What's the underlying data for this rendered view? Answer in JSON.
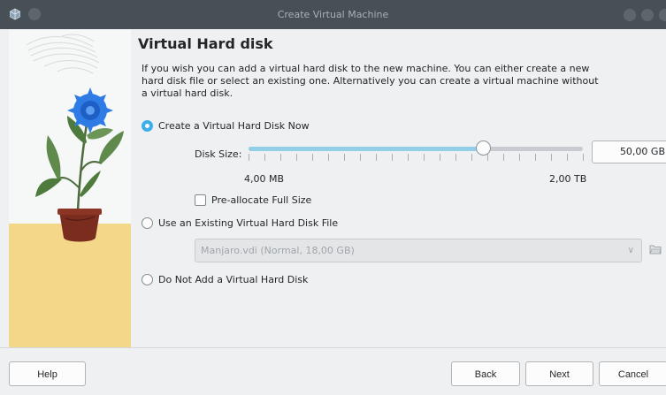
{
  "window": {
    "title": "Create Virtual Machine"
  },
  "page": {
    "heading": "Virtual Hard disk",
    "description": "If you wish you can add a virtual hard disk to the new machine. You can either create a new hard disk file or select an existing one. Alternatively you can create a virtual machine without a virtual hard disk."
  },
  "options": {
    "create_new": {
      "label": "Create a Virtual Hard Disk Now",
      "checked": true
    },
    "use_existing": {
      "label": "Use an Existing Virtual Hard Disk File",
      "checked": false
    },
    "no_disk": {
      "label": "Do Not Add a Virtual Hard Disk",
      "checked": false
    }
  },
  "disk_size": {
    "label": "Disk Size:",
    "value": "50,00 GB",
    "min_label": "4,00 MB",
    "max_label": "2,00 TB",
    "slider_fraction": 0.7
  },
  "preallocate": {
    "label": "Pre-allocate Full Size",
    "checked": false
  },
  "existing_file": {
    "selected": "Manjaro.vdi (Normal, 18,00 GB)",
    "enabled": false
  },
  "buttons": {
    "help": "Help",
    "back": "Back",
    "next": "Next",
    "cancel": "Cancel"
  },
  "icons": {
    "app": "virtualbox-icon",
    "folder": "folder-open-icon",
    "dropdown": "chevron-down-icon"
  },
  "colors": {
    "accent": "#3daee9",
    "titlebar": "#475057"
  }
}
